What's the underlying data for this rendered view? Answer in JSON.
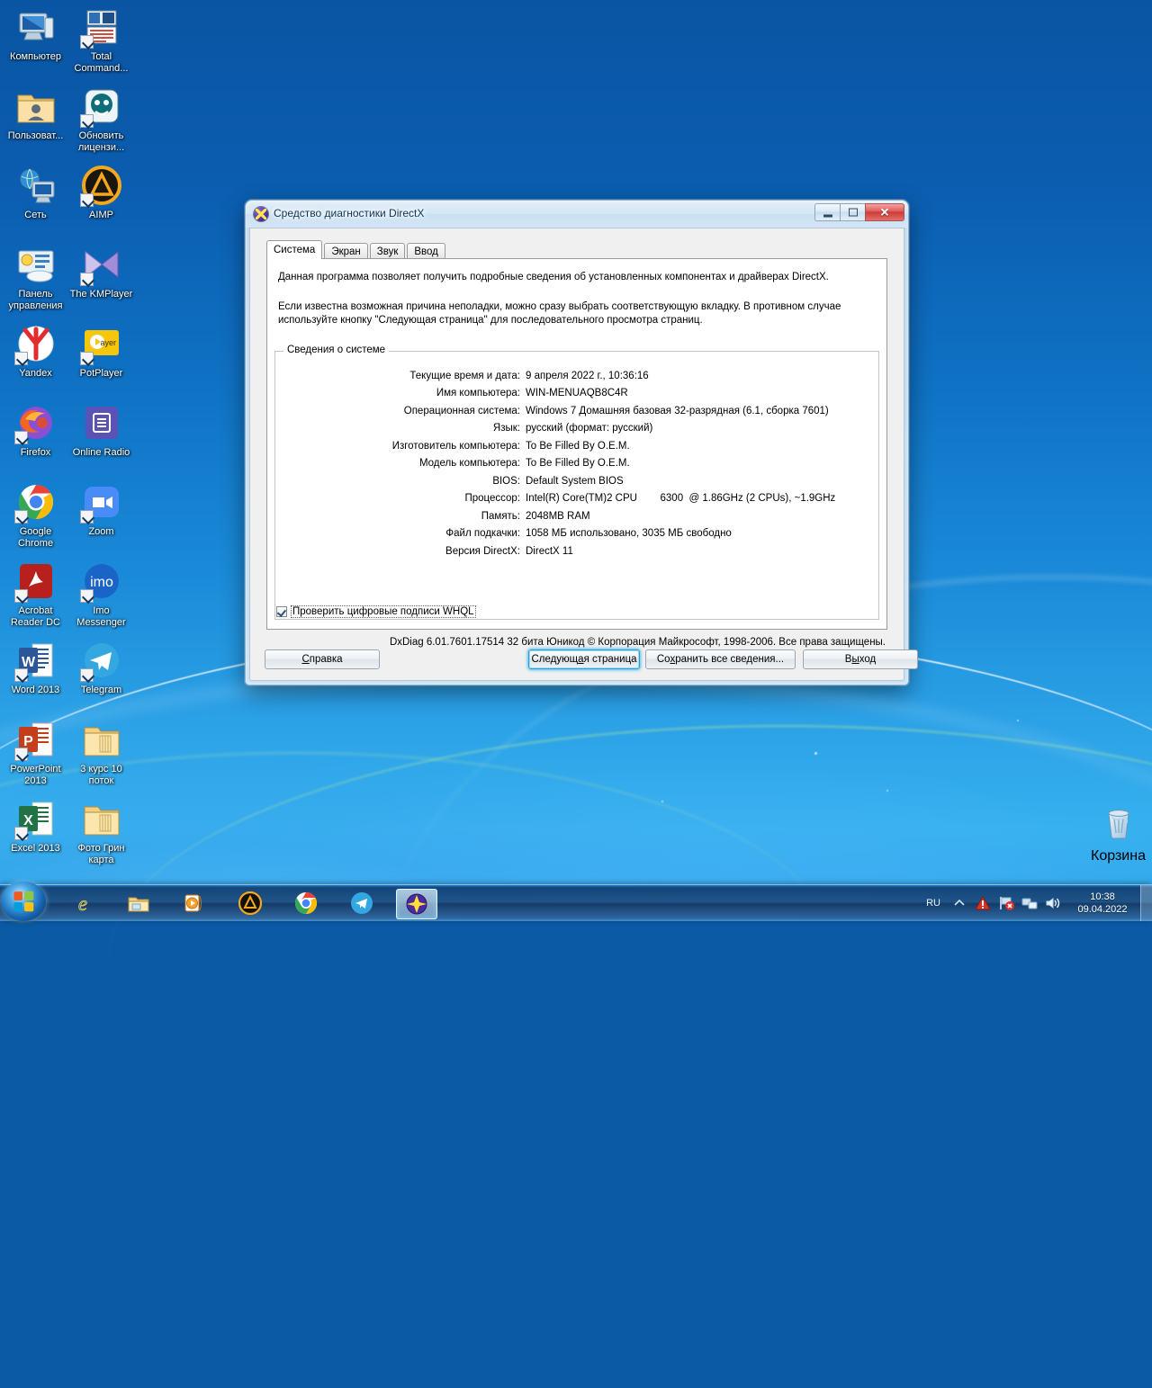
{
  "desktop": {
    "icons": [
      {
        "label": "Компьютер",
        "icon": "computer-icon",
        "shortcut": false
      },
      {
        "label": "Total Command...",
        "icon": "total-commander-icon",
        "shortcut": true
      },
      {
        "label": "Пользоват...",
        "icon": "user-folder-icon",
        "shortcut": false
      },
      {
        "label": "Обновить лицензи...",
        "icon": "license-update-icon",
        "shortcut": true
      },
      {
        "label": "Сеть",
        "icon": "network-icon",
        "shortcut": false
      },
      {
        "label": "AIMP",
        "icon": "aimp-icon",
        "shortcut": true
      },
      {
        "label": "Панель управления",
        "icon": "control-panel-icon",
        "shortcut": false
      },
      {
        "label": "The KMPlayer",
        "icon": "kmplayer-icon",
        "shortcut": true
      },
      {
        "label": "Yandex",
        "icon": "yandex-browser-icon",
        "shortcut": true
      },
      {
        "label": "PotPlayer",
        "icon": "potplayer-icon",
        "shortcut": true
      },
      {
        "label": "Firefox",
        "icon": "firefox-icon",
        "shortcut": true
      },
      {
        "label": "Online Radio",
        "icon": "online-radio-icon",
        "shortcut": false
      },
      {
        "label": "Google Chrome",
        "icon": "chrome-icon",
        "shortcut": true
      },
      {
        "label": "Zoom",
        "icon": "zoom-icon",
        "shortcut": true
      },
      {
        "label": "Acrobat Reader DC",
        "icon": "acrobat-reader-icon",
        "shortcut": true
      },
      {
        "label": "Imo Messenger",
        "icon": "imo-messenger-icon",
        "shortcut": true
      },
      {
        "label": "Word 2013",
        "icon": "word-icon",
        "shortcut": true
      },
      {
        "label": "Telegram",
        "icon": "telegram-icon",
        "shortcut": true
      },
      {
        "label": "PowerPoint 2013",
        "icon": "powerpoint-icon",
        "shortcut": true
      },
      {
        "label": "3 курс 10 поток",
        "icon": "folder-icon",
        "shortcut": false
      },
      {
        "label": "Excel 2013",
        "icon": "excel-icon",
        "shortcut": true
      },
      {
        "label": "Фото Грин карта",
        "icon": "folder-icon",
        "shortcut": false
      }
    ],
    "recycle_bin": {
      "label": "Корзина",
      "icon": "recycle-bin-icon"
    }
  },
  "window": {
    "title": "Средство диагностики DirectX",
    "icon": "directx-icon",
    "controls": {
      "minimize": "minimize-icon",
      "maximize": "maximize-icon",
      "close": "✕"
    },
    "tabs": [
      {
        "label": "Система",
        "active": true
      },
      {
        "label": "Экран",
        "active": false
      },
      {
        "label": "Звук",
        "active": false
      },
      {
        "label": "Ввод",
        "active": false
      }
    ],
    "intro_line1": "Данная программа позволяет получить подробные сведения об установленных компонентах и драйверах DirectX.",
    "intro_line2": "Если известна возможная причина неполадки, можно сразу выбрать соответствующую вкладку. В противном случае используйте кнопку \"Следующая страница\" для последовательного просмотра страниц.",
    "group_title": "Сведения о системе",
    "system_info": [
      {
        "key": "Текущие время и дата:",
        "value": "9 апреля 2022 г., 10:36:16"
      },
      {
        "key": "Имя компьютера:",
        "value": "WIN-MENUAQB8C4R"
      },
      {
        "key": "Операционная система:",
        "value": "Windows 7 Домашняя базовая 32-разрядная (6.1, сборка 7601)"
      },
      {
        "key": "Язык:",
        "value": "русский (формат: русский)"
      },
      {
        "key": "Изготовитель компьютера:",
        "value": "To Be Filled By O.E.M."
      },
      {
        "key": "Модель компьютера:",
        "value": "To Be Filled By O.E.M."
      },
      {
        "key": "BIOS:",
        "value": "Default System BIOS"
      },
      {
        "key": "Процессор:",
        "value": "Intel(R) Core(TM)2 CPU        6300  @ 1.86GHz (2 CPUs), ~1.9GHz"
      },
      {
        "key": "Память:",
        "value": "2048MB RAM"
      },
      {
        "key": "Файл подкачки:",
        "value": "1058 МБ использовано, 3035 МБ свободно"
      },
      {
        "key": "Версия DirectX:",
        "value": "DirectX 11"
      }
    ],
    "whql_checkbox": {
      "label": "Проверить цифровые подписи WHQL",
      "checked": true
    },
    "copyright": "DxDiag 6.01.7601.17514 32 бита Юникод  © Корпорация Майкрософт, 1998-2006.  Все права защищены.",
    "buttons": [
      {
        "label": "Справка",
        "default": false
      },
      {
        "label": "Следующая страница",
        "default": true
      },
      {
        "label": "Сохранить все сведения...",
        "default": false
      },
      {
        "label": "Выход",
        "default": false
      }
    ]
  },
  "taskbar": {
    "start": {
      "name": "start-orb",
      "tooltip": "Пуск"
    },
    "items": [
      {
        "icon": "internet-explorer-icon",
        "active": false
      },
      {
        "icon": "windows-explorer-icon",
        "active": false
      },
      {
        "icon": "media-player-icon",
        "active": false
      },
      {
        "icon": "aimp-icon",
        "active": false
      },
      {
        "icon": "chrome-icon",
        "active": false
      },
      {
        "icon": "telegram-icon",
        "active": false
      },
      {
        "icon": "directx-icon",
        "active": true
      }
    ],
    "tray": {
      "language": "RU",
      "icons": [
        "show-hidden-icons-chevron",
        "action-center-warning-icon",
        "network-flag-error-icon",
        "network-icon",
        "volume-icon"
      ],
      "time": "10:38",
      "date": "09.04.2022"
    }
  },
  "colors": {
    "desktop_top": "#0a55a3",
    "desktop_bottom": "#36b1ef",
    "window_chrome": "#dceaf7",
    "default_button_glow": "#3cb9eb",
    "close_button": "#cd3b37",
    "warning_icon": "#d93025"
  }
}
